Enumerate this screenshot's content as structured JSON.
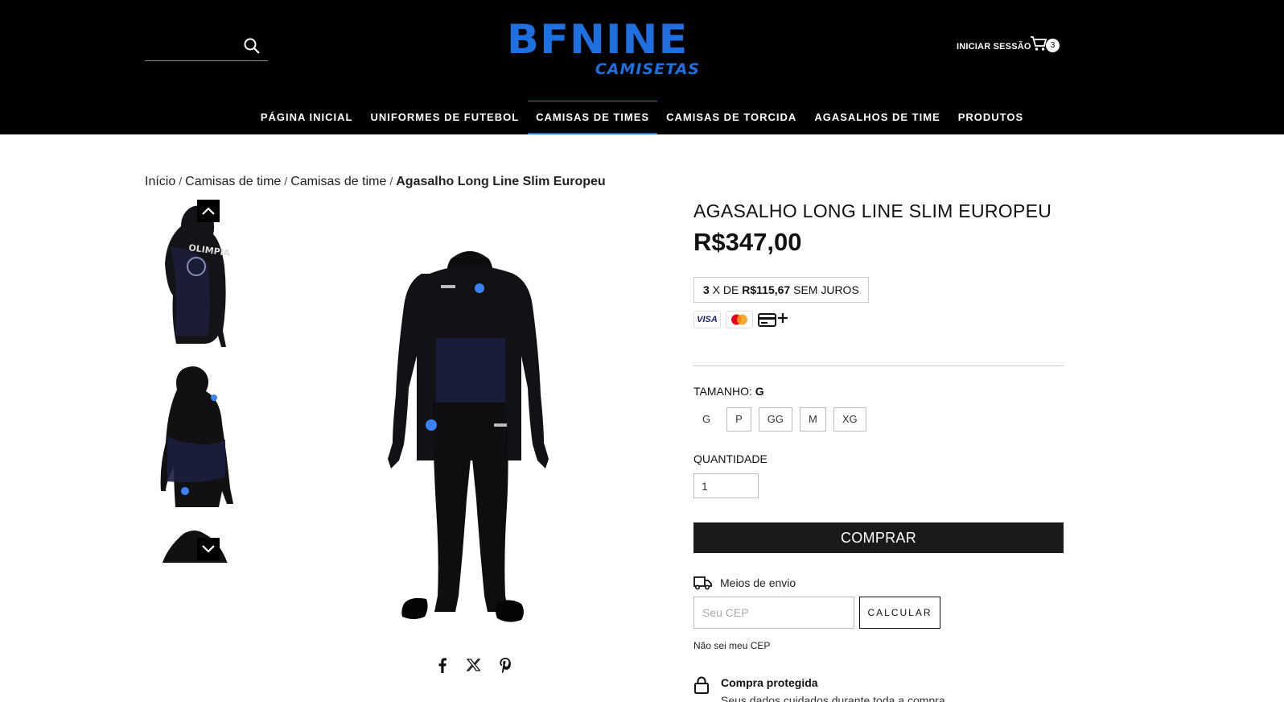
{
  "header": {
    "logo_main": "BFNINE",
    "logo_sub": "CAMISETAS",
    "login_label": "INICIAR SESSÃO",
    "cart_count": "3",
    "search_placeholder": ""
  },
  "nav": {
    "items": [
      {
        "label": "PÁGINA INICIAL"
      },
      {
        "label": "UNIFORMES DE FUTEBOL"
      },
      {
        "label": "CAMISAS DE TIMES"
      },
      {
        "label": "CAMISAS DE TORCIDA"
      },
      {
        "label": "AGASALHOS DE TIME"
      },
      {
        "label": "PRODUTOS"
      }
    ],
    "active_index": 2
  },
  "breadcrumb": {
    "items": [
      "Início",
      "Camisas de time",
      "Camisas de time"
    ],
    "current": "Agasalho Long Line Slim Europeu",
    "separator": "/"
  },
  "product": {
    "title": "AGASALHO LONG LINE SLIM EUROPEU",
    "price": "R$347,00",
    "installments": {
      "count": "3",
      "middle": " X DE ",
      "amount": "R$115,67",
      "suffix": " SEM JUROS"
    },
    "payment_methods": [
      "visa",
      "mastercard",
      "card-plus"
    ],
    "visa_label": "VISA",
    "size_label": "TAMANHO:",
    "size_selected": "G",
    "sizes": [
      "G",
      "P",
      "GG",
      "M",
      "XG"
    ],
    "quantity_label": "QUANTIDADE",
    "quantity_value": "1",
    "buy_label": "COMPRAR"
  },
  "shipping": {
    "label": "Meios de envio",
    "cep_placeholder": "Seu CEP",
    "calc_label": "CALCULAR",
    "no_cep": "Não sei meu CEP"
  },
  "protected": {
    "title": "Compra protegida",
    "subtitle": "Seus dados cuidados durante toda a compra."
  },
  "colors": {
    "brand_blue": "#1e6fe0",
    "header_bg": "#000000",
    "button_dark": "#1a1a1a"
  }
}
